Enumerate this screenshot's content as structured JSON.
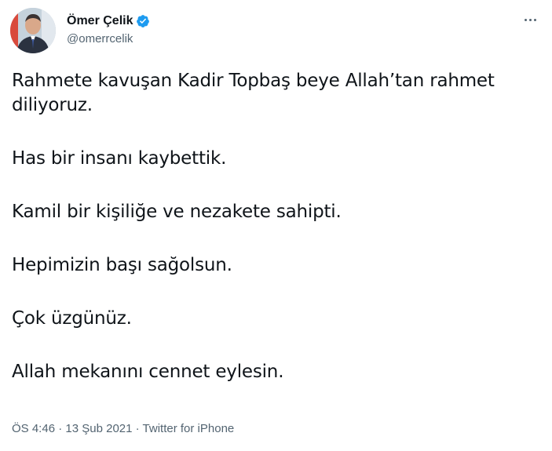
{
  "author": {
    "display_name": "Ömer Çelik",
    "handle": "@omerrcelik",
    "verified": true,
    "avatar": "avatar-photo"
  },
  "icons": {
    "verified": "verified-badge-icon",
    "more": "more-options-icon"
  },
  "colors": {
    "verified_blue": "#1d9bf0",
    "text": "#0f1419",
    "secondary": "#536471"
  },
  "tweet": {
    "paragraphs": [
      "Rahmete kavuşan Kadir Topbaş beye Allah’tan rahmet diliyoruz.",
      "Has bir insanı kaybettik.",
      "Kamil bir kişiliğe ve nezakete sahipti.",
      "Hepimizin başı sağolsun.",
      "Çok üzgünüz.",
      "Allah mekanını cennet eylesin."
    ]
  },
  "footer": {
    "time": "ÖS 4:46",
    "separator": " · ",
    "date": "13 Şub 2021",
    "source": "Twitter for iPhone"
  }
}
